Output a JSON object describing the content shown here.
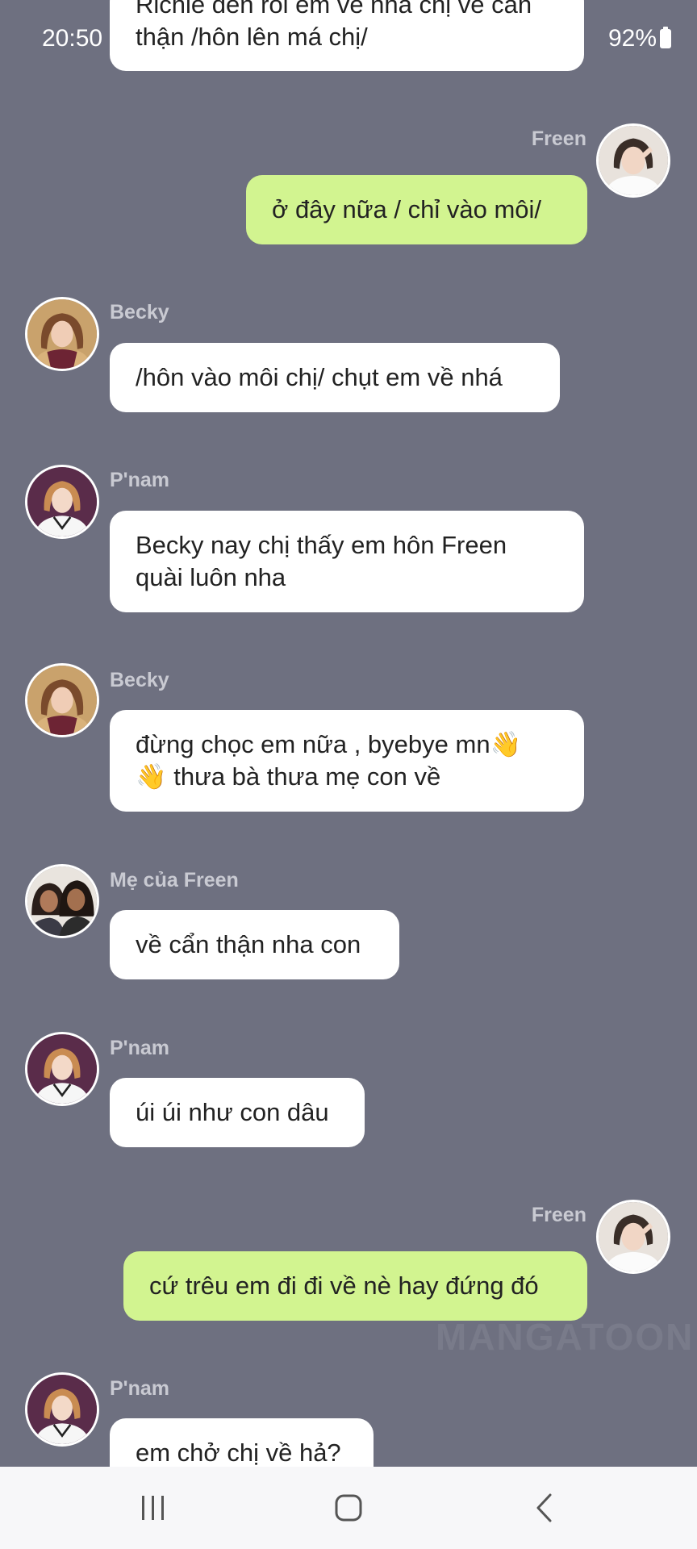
{
  "status_bar": {
    "time": "20:50",
    "battery": "92%"
  },
  "messages": [
    {
      "sender": "",
      "text": "Richie đến rồi em về nha chị về cẩn thận /hôn lên má chị/",
      "side": "in"
    },
    {
      "sender": "Freen",
      "text": "ở đây nữa / chỉ vào môi/",
      "side": "out"
    },
    {
      "sender": "Becky",
      "text": "/hôn vào môi chị/ chụt em về nhá",
      "side": "in"
    },
    {
      "sender": "P'nam",
      "text": "Becky nay chị thấy em hôn Freen\nquài luôn nha",
      "side": "in"
    },
    {
      "sender": "Becky",
      "text": "đừng chọc em nữa , byebye mn👋\n👋 thưa bà thưa mẹ con về",
      "side": "in"
    },
    {
      "sender": "Mẹ của Freen",
      "text": "về cẩn thận nha con",
      "side": "in"
    },
    {
      "sender": "P'nam",
      "text": "úi úi như con dâu",
      "side": "in"
    },
    {
      "sender": "Freen",
      "text": "cứ trêu em đi đi về nè hay đứng đó",
      "side": "out"
    },
    {
      "sender": "P'nam",
      "text": "em chở chị về hả?",
      "side": "in"
    }
  ],
  "watermark": "MANGATOON",
  "avatars": {
    "freen": "freen-avatar",
    "becky": "becky-avatar",
    "pnam": "pnam-avatar",
    "me_cua_freen": "mother-avatar"
  },
  "colors": {
    "background": "#6e7080",
    "incoming_bubble": "#ffffff",
    "outgoing_bubble": "#d2f490",
    "sender_name": "#c9cad2",
    "navbar": "#f7f7f9"
  },
  "nav": {
    "recents": "recents-icon",
    "home": "home-icon",
    "back": "back-icon"
  }
}
